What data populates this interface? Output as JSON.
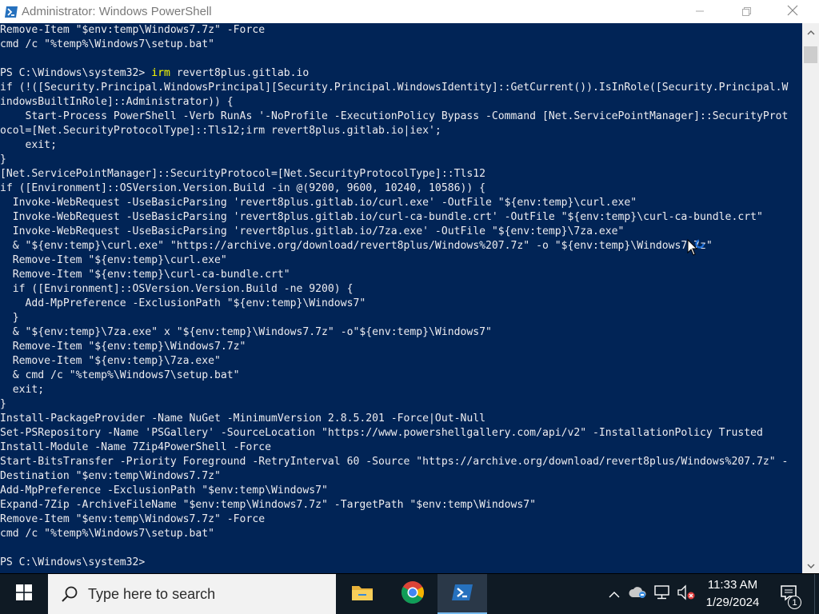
{
  "window": {
    "title": "Administrator: Windows PowerShell",
    "app_icon": "powershell-icon",
    "controls": {
      "minimize": "minimize-icon",
      "maximize": "maximize-icon",
      "close": "close-icon"
    }
  },
  "colors": {
    "console_bg": "#012456",
    "console_text": "#eeedf0",
    "command_text": "#ffff00",
    "taskbar_bg": "#0f1a24",
    "search_bg": "#f2f2f2"
  },
  "console": {
    "lines": [
      {
        "text": "Remove-Item \"$env:temp\\Windows7.7z\" -Force"
      },
      {
        "text": "cmd /c \"%temp%\\Windows7\\setup.bat\""
      },
      {
        "text": ""
      },
      {
        "prompt": "PS C:\\Windows\\system32> ",
        "cmd": "irm",
        "text": " revert8plus.gitlab.io"
      },
      {
        "text": "if (!([Security.Principal.WindowsPrincipal][Security.Principal.WindowsIdentity]::GetCurrent()).IsInRole([Security.Principal.W"
      },
      {
        "text": "indowsBuiltInRole]::Administrator)) {"
      },
      {
        "text": "    Start-Process PowerShell -Verb RunAs '-NoProfile -ExecutionPolicy Bypass -Command [Net.ServicePointManager]::SecurityProt"
      },
      {
        "text": "ocol=[Net.SecurityProtocolType]::Tls12;irm revert8plus.gitlab.io|iex';"
      },
      {
        "text": "    exit;"
      },
      {
        "text": "}"
      },
      {
        "text": "[Net.ServicePointManager]::SecurityProtocol=[Net.SecurityProtocolType]::Tls12"
      },
      {
        "text": "if ([Environment]::OSVersion.Version.Build -in @(9200, 9600, 10240, 10586)) {"
      },
      {
        "text": "  Invoke-WebRequest -UseBasicParsing 'revert8plus.gitlab.io/curl.exe' -OutFile \"${env:temp}\\curl.exe\""
      },
      {
        "text": "  Invoke-WebRequest -UseBasicParsing 'revert8plus.gitlab.io/curl-ca-bundle.crt' -OutFile \"${env:temp}\\curl-ca-bundle.crt\""
      },
      {
        "text": "  Invoke-WebRequest -UseBasicParsing 'revert8plus.gitlab.io/7za.exe' -OutFile \"${env:temp}\\7za.exe\""
      },
      {
        "text": "  & \"${env:temp}\\curl.exe\" \"https://archive.org/download/revert8plus/Windows%207.7z\" -o \"${env:temp}\\Windows7.7z\""
      },
      {
        "text": "  Remove-Item \"${env:temp}\\curl.exe\""
      },
      {
        "text": "  Remove-Item \"${env:temp}\\curl-ca-bundle.crt\""
      },
      {
        "text": "  if ([Environment]::OSVersion.Version.Build -ne 9200) {"
      },
      {
        "text": "    Add-MpPreference -ExclusionPath \"${env:temp}\\Windows7\""
      },
      {
        "text": "  }"
      },
      {
        "text": "  & \"${env:temp}\\7za.exe\" x \"${env:temp}\\Windows7.7z\" -o\"${env:temp}\\Windows7\""
      },
      {
        "text": "  Remove-Item \"${env:temp}\\Windows7.7z\""
      },
      {
        "text": "  Remove-Item \"${env:temp}\\7za.exe\""
      },
      {
        "text": "  & cmd /c \"%temp%\\Windows7\\setup.bat\""
      },
      {
        "text": "  exit;"
      },
      {
        "text": "}"
      },
      {
        "text": "Install-PackageProvider -Name NuGet -MinimumVersion 2.8.5.201 -Force|Out-Null"
      },
      {
        "text": "Set-PSRepository -Name 'PSGallery' -SourceLocation \"https://www.powershellgallery.com/api/v2\" -InstallationPolicy Trusted"
      },
      {
        "text": "Install-Module -Name 7Zip4PowerShell -Force"
      },
      {
        "text": "Start-BitsTransfer -Priority Foreground -RetryInterval 60 -Source \"https://archive.org/download/revert8plus/Windows%207.7z\" -"
      },
      {
        "text": "Destination \"$env:temp\\Windows7.7z\""
      },
      {
        "text": "Add-MpPreference -ExclusionPath \"$env:temp\\Windows7\""
      },
      {
        "text": "Expand-7Zip -ArchiveFileName \"$env:temp\\Windows7.7z\" -TargetPath \"$env:temp\\Windows7\""
      },
      {
        "text": "Remove-Item \"$env:temp\\Windows7.7z\" -Force"
      },
      {
        "text": "cmd /c \"%temp%\\Windows7\\setup.bat\""
      },
      {
        "text": ""
      },
      {
        "prompt": "PS C:\\Windows\\system32> ",
        "cmd": "",
        "text": ""
      }
    ]
  },
  "scrollbar": {
    "up": "scroll-up-arrow-icon",
    "down": "scroll-down-arrow-icon"
  },
  "taskbar": {
    "start": "windows-logo-icon",
    "search_placeholder": "Type here to search",
    "search_icon": "search-icon",
    "apps": [
      {
        "name": "file-explorer",
        "icon": "folder-icon"
      },
      {
        "name": "google-chrome",
        "icon": "chrome-icon"
      },
      {
        "name": "windows-powershell",
        "icon": "powershell-icon",
        "active": true
      }
    ],
    "tray": {
      "chevron": "chevron-up-icon",
      "onedrive": "cloud-icon",
      "network": "network-icon",
      "volume": "speaker-muted-icon"
    },
    "clock": {
      "time": "11:33 AM",
      "date": "1/29/2024"
    },
    "notifications": {
      "icon": "action-center-icon",
      "count": "1"
    }
  }
}
